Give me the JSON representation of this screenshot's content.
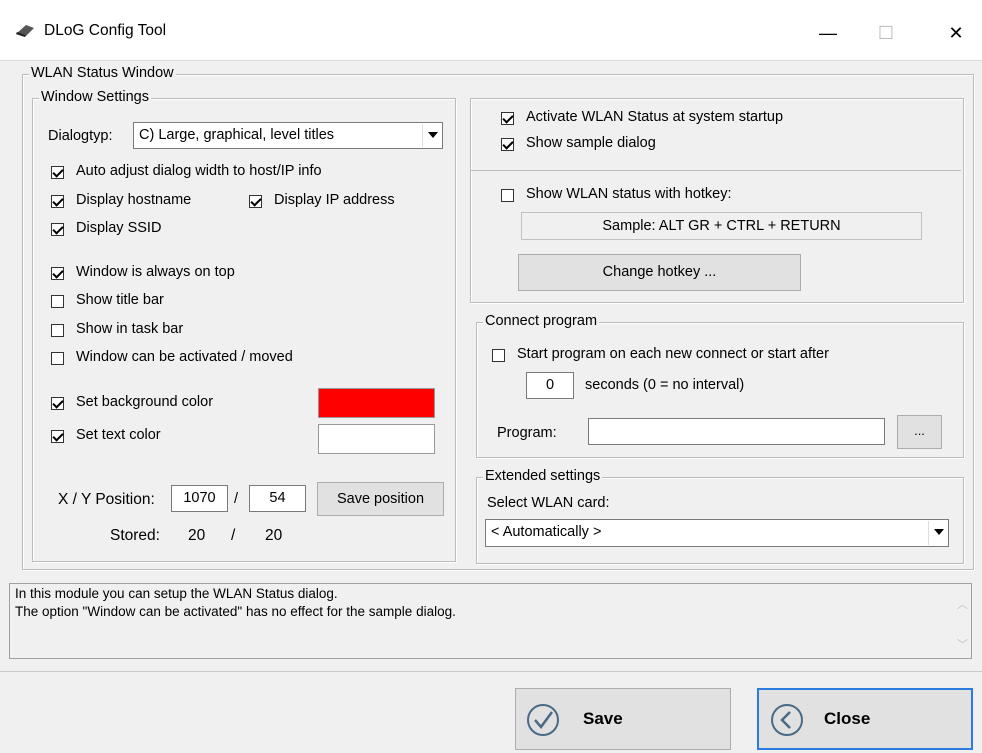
{
  "window": {
    "title": "DLoG Config Tool",
    "minimize": "—",
    "maximize": "☐",
    "close": "✕"
  },
  "main_group": {
    "legend": "WLAN Status Window"
  },
  "window_settings": {
    "legend": "Window Settings",
    "dialogtyp_label": "Dialogtyp:",
    "dialogtyp_value": "C) Large, graphical, level titles",
    "auto_adjust": "Auto adjust dialog width to host/IP info",
    "display_hostname": "Display hostname",
    "display_ip": "Display IP address",
    "display_ssid": "Display SSID",
    "always_on_top": "Window is always on top",
    "show_title_bar": "Show title bar",
    "show_in_task_bar": "Show in task bar",
    "can_be_activated": "Window can be activated / moved",
    "set_bg_color": "Set background color",
    "set_text_color": "Set text color",
    "bg_color": "#ff0000",
    "text_color": "#ffffff",
    "xy_label": "X / Y Position:",
    "x_value": "1070",
    "slash": "/",
    "y_value": "54",
    "save_position": "Save position",
    "stored_label": "Stored:",
    "stored_x": "20",
    "stored_y": "20"
  },
  "activation": {
    "activate_startup": "Activate WLAN Status at system startup",
    "show_sample": "Show sample dialog",
    "show_hotkey": "Show WLAN status with hotkey:",
    "sample_hotkey": "Sample: ALT GR + CTRL + RETURN",
    "change_hotkey": "Change hotkey ..."
  },
  "connect_program": {
    "legend": "Connect program",
    "start_program": "Start program on each new connect or start after",
    "seconds_value": "0",
    "seconds_label": "seconds (0 = no interval)",
    "program_label": "Program:",
    "program_value": "",
    "browse": "..."
  },
  "extended": {
    "legend": "Extended settings",
    "select_card_label": "Select WLAN card:",
    "card_value": "< Automatically >"
  },
  "info": {
    "line1": "In this module you can setup the WLAN Status dialog.",
    "line2": "The option \"Window can be activated\" has no effect for the sample dialog."
  },
  "footer": {
    "save": "Save",
    "close": "Close"
  }
}
